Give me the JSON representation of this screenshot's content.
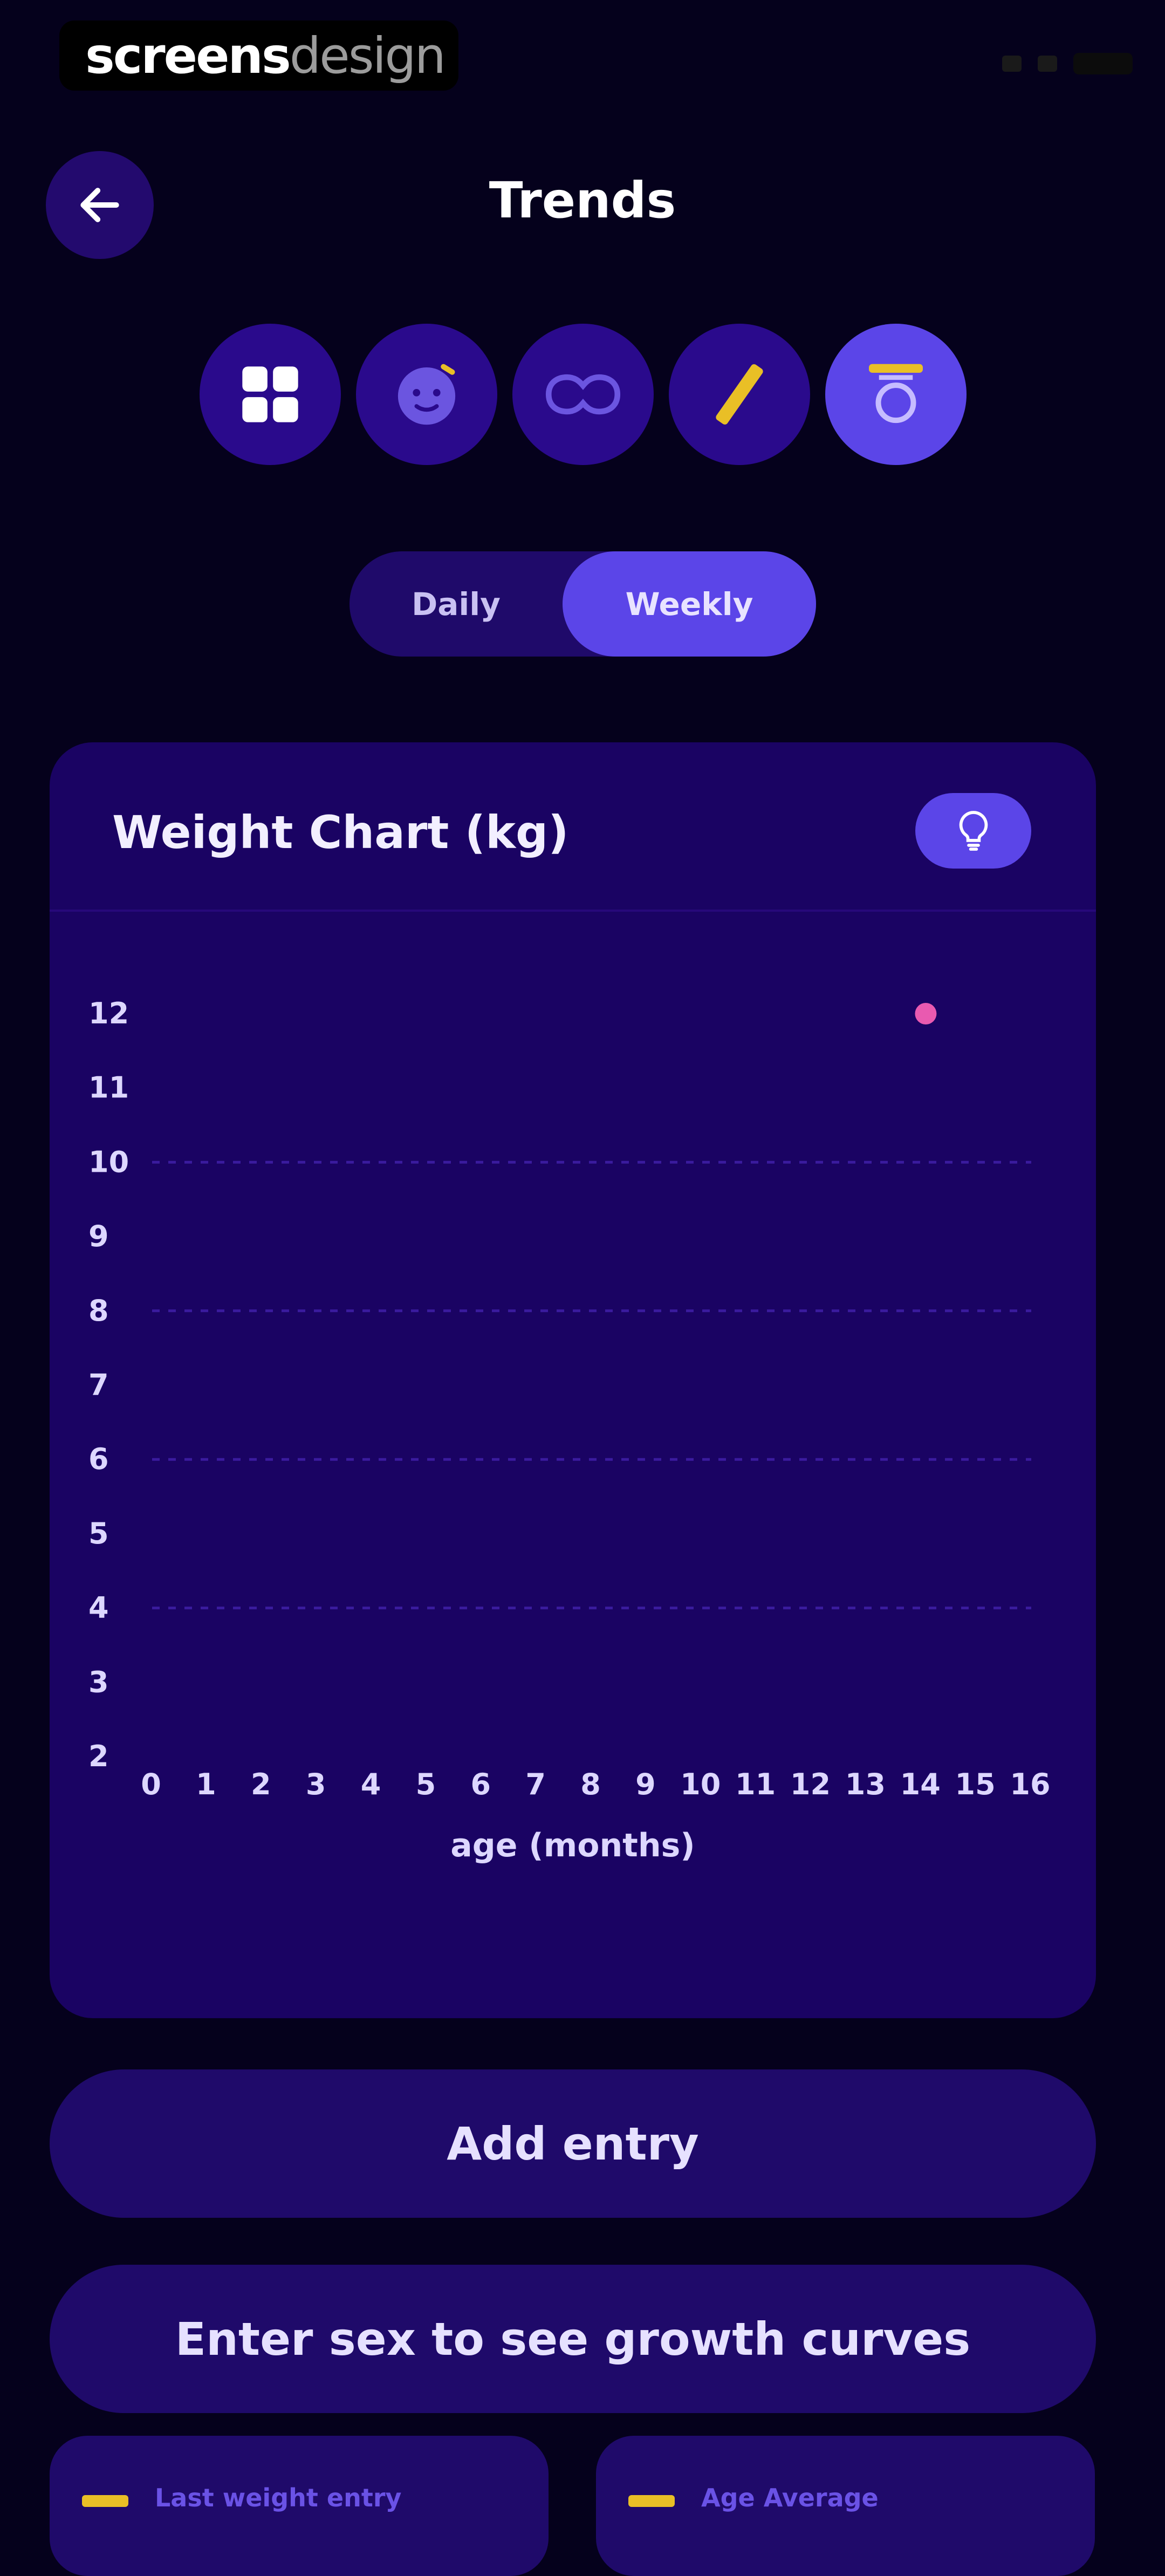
{
  "watermark": {
    "part1": "screens",
    "part2": "design"
  },
  "header": {
    "title": "Trends"
  },
  "categories": [
    {
      "icon": "grid-icon",
      "active": false
    },
    {
      "icon": "baby-face-icon",
      "active": false
    },
    {
      "icon": "sleep-mask-icon",
      "active": false
    },
    {
      "icon": "ruler-icon",
      "active": false
    },
    {
      "icon": "scale-icon",
      "active": true
    }
  ],
  "period_toggle": {
    "daily": "Daily",
    "weekly": "Weekly",
    "selected": "Weekly"
  },
  "chart_card": {
    "title": "Weight Chart (kg)"
  },
  "chart_data": {
    "type": "scatter",
    "title": "Weight Chart (kg)",
    "xlabel": "age (months)",
    "ylabel": "",
    "x_ticks": [
      "0",
      "1",
      "2",
      "3",
      "4",
      "5",
      "6",
      "7",
      "8",
      "9",
      "10",
      "11",
      "12",
      "13",
      "14",
      "15",
      "16"
    ],
    "y_ticks": [
      "12",
      "11",
      "10",
      "9",
      "8",
      "7",
      "6",
      "5",
      "4",
      "3",
      "2"
    ],
    "xlim": [
      0,
      16
    ],
    "ylim": [
      2,
      12
    ],
    "gridlines_y": [
      4,
      6,
      8,
      10
    ],
    "series": [
      {
        "x": [
          14.1
        ],
        "y": [
          12
        ],
        "color": "#e95ab0"
      }
    ]
  },
  "buttons": {
    "add_entry": "Add entry",
    "growth_curves": "Enter sex to see growth curves"
  },
  "stats": {
    "last_weight_label": "Last weight entry",
    "age_average_label": "Age Average"
  },
  "colors": {
    "background": "#05011c",
    "card": "#1a0363",
    "accent": "#5b45e8",
    "highlight": "#e9bf26",
    "point": "#e95ab0"
  }
}
